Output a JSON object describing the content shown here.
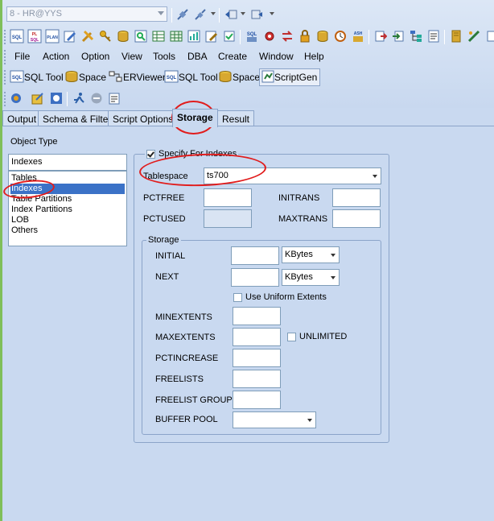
{
  "connection": {
    "value": "8 - HR@YYS"
  },
  "menu": [
    "File",
    "Action",
    "Option",
    "View",
    "Tools",
    "DBA",
    "Create",
    "Window",
    "Help"
  ],
  "window_tabs": [
    {
      "label": "SQL Tool",
      "icon": "sql-tool-icon"
    },
    {
      "label": "Space",
      "icon": "space-icon"
    },
    {
      "label": "ERViewer",
      "icon": "erviewer-icon"
    },
    {
      "label": "SQL Tool",
      "icon": "sql-tool-icon"
    },
    {
      "label": "Space",
      "icon": "space-icon"
    },
    {
      "label": "ScriptGen",
      "icon": "scriptgen-icon"
    }
  ],
  "tabs": [
    "Output",
    "Schema & Filter",
    "Script Options",
    "Storage",
    "Result"
  ],
  "active_tab": "Storage",
  "object_type": {
    "label": "Object Type",
    "selected": "Indexes",
    "items": [
      "Tables",
      "Indexes",
      "Table Partitions",
      "Index Partitions",
      "LOB",
      "Others"
    ]
  },
  "specify": {
    "label": "Specify For Indexes",
    "checked": true
  },
  "tablespace": {
    "label": "Tablespace",
    "value": "ts700"
  },
  "pctfree": {
    "label": "PCTFREE",
    "value": ""
  },
  "pctused": {
    "label": "PCTUSED",
    "value": ""
  },
  "initrans": {
    "label": "INITRANS",
    "value": ""
  },
  "maxtrans": {
    "label": "MAXTRANS",
    "value": ""
  },
  "storage": {
    "title": "Storage",
    "initial": {
      "label": "INITIAL",
      "value": "",
      "unit": "KBytes"
    },
    "next": {
      "label": "NEXT",
      "value": "",
      "unit": "KBytes"
    },
    "uniform": {
      "label": "Use Uniform Extents",
      "checked": false
    },
    "minextents": {
      "label": "MINEXTENTS",
      "value": ""
    },
    "maxextents": {
      "label": "MAXEXTENTS",
      "value": ""
    },
    "unlimited": {
      "label": "UNLIMITED",
      "checked": false
    },
    "pctincrease": {
      "label": "PCTINCREASE",
      "value": ""
    },
    "freelists": {
      "label": "FREELISTS",
      "value": ""
    },
    "freelist_groups": {
      "label": "FREELIST GROUPS",
      "value": ""
    },
    "buffer_pool": {
      "label": "BUFFER POOL",
      "value": ""
    }
  },
  "icon_labels": {
    "sql": "SQL",
    "pl": "PL",
    "plan": "PLAN",
    "ash": "ASH"
  },
  "colors": {
    "background": "#c9d9f0",
    "selection": "#3b72c7",
    "annotation": "#e11c1c"
  }
}
